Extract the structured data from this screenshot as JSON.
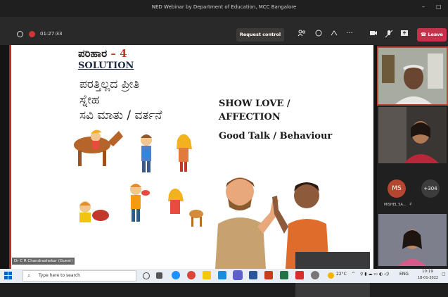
{
  "window": {
    "title": "NED Webinar by Department of Education, MCC Bangalore",
    "minimize": "–",
    "maximize": "□"
  },
  "meeting": {
    "timer": "01:27:33",
    "request_control_label": "Request control",
    "leave_label": "Leave",
    "toolbar_icons": [
      "people-icon",
      "chat-icon",
      "reactions-icon",
      "more-icon",
      "camera-icon",
      "mic-off-icon",
      "share-icon"
    ]
  },
  "slide": {
    "kannada_title": "ಪರಿಹಾರ",
    "title_number": "– 4",
    "solution": "SOLUTION",
    "kannada_lines": [
      "ಪರತ್ತಿಲ್ಲದ ಪ್ರೀತಿ",
      "ಸ್ನೇಹ",
      "ಸವಿ ಮಾತು / ವರ್ತನೆ"
    ],
    "english_lines": [
      "SHOW LOVE /",
      "AFFECTION",
      "Good Talk / Behaviour"
    ]
  },
  "presenter_name": "Dr C R Chandrashekar (Guest)",
  "participants": {
    "initials": "MS",
    "more_count": "+304",
    "name": "MISHEL SA...",
    "colors": {
      "ms_avatar": "#b4452f",
      "more_avatar": "#3c3c3c"
    }
  },
  "taskbar": {
    "search_placeholder": "Type here to search",
    "temperature": "22°C",
    "language": "ENG",
    "time": "10:19",
    "date": "18-01-2022"
  },
  "colors": {
    "leave_red": "#c4314b",
    "slide_border": "#c02a2a"
  }
}
